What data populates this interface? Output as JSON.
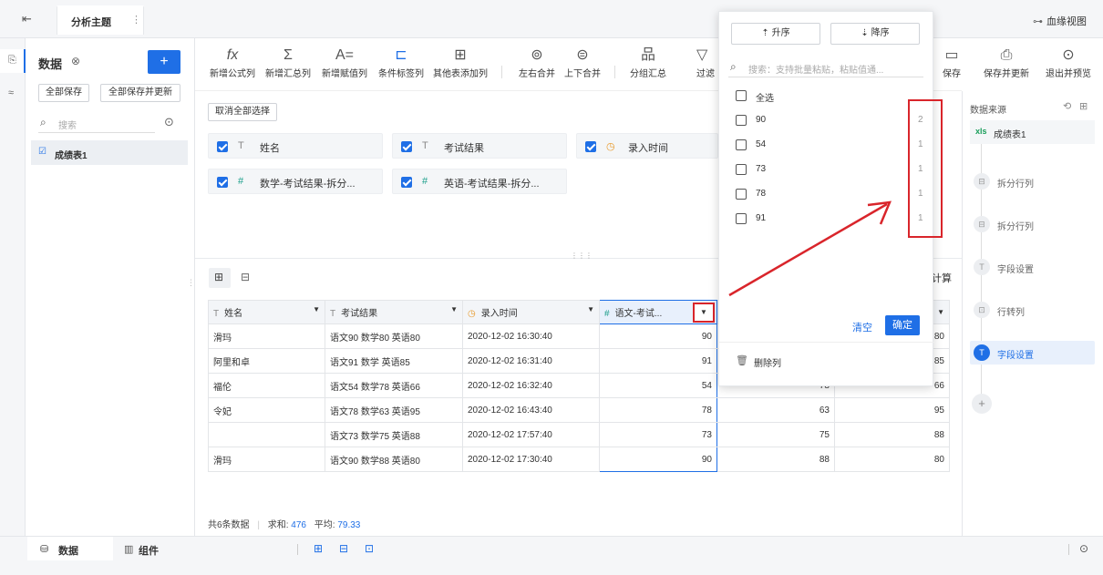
{
  "topbar": {
    "back_icon": "exit-icon",
    "tab_title": "分析主题",
    "more": "⋮",
    "lineage": "血缘视图"
  },
  "left_rail": {
    "icons": [
      "transform-icon",
      "lineage-icon"
    ]
  },
  "data_panel": {
    "title": "数据",
    "add": "+",
    "save_all": "全部保存",
    "save_all_update": "全部保存并更新",
    "search_placeholder": "搜索",
    "tables": [
      "成绩表1"
    ]
  },
  "toolbar": {
    "items": [
      "新增公式列",
      "新增汇总列",
      "新增赋值列",
      "条件标签列",
      "其他表添加列",
      "左右合并",
      "上下合并",
      "分组汇总",
      "过滤"
    ],
    "right_items": [
      "保存",
      "保存并更新",
      "退出并预览"
    ]
  },
  "field_area": {
    "deselect_all": "取消全部选择",
    "fields": [
      {
        "type": "T",
        "name": "姓名"
      },
      {
        "type": "T",
        "name": "考试结果"
      },
      {
        "type": "◷",
        "name": "录入时间"
      },
      {
        "type": "#",
        "name": "数学-考试结果-拆分..."
      },
      {
        "type": "#",
        "name": "英语-考试结果-拆分..."
      }
    ],
    "handle": "⋮⋮⋮"
  },
  "grid": {
    "columns": [
      {
        "type": "T",
        "name": "姓名"
      },
      {
        "type": "T",
        "name": "考试结果"
      },
      {
        "type": "◷",
        "name": "录入时间"
      },
      {
        "type": "#",
        "name": "语文-考试..."
      },
      {
        "type": "#",
        "name": ""
      },
      {
        "type": "#",
        "name": ""
      }
    ],
    "rows": [
      [
        "滑玛",
        "语文90 数学80 英语80",
        "2020-12-02 16:30:40",
        "90",
        "",
        "80"
      ],
      [
        "阿里和卓",
        "语文91 数学 英语85",
        "2020-12-02 16:31:40",
        "91",
        "",
        "85"
      ],
      [
        "福伦",
        "语文54 数学78 英语66",
        "2020-12-02 16:32:40",
        "54",
        "78",
        "66"
      ],
      [
        "令妃",
        "语文78 数学63 英语95",
        "2020-12-02 16:43:40",
        "78",
        "63",
        "95"
      ],
      [
        "",
        "语文73 数学75 英语88",
        "2020-12-02 17:57:40",
        "73",
        "75",
        "88"
      ],
      [
        "滑玛",
        "语文90 数学88 英语80",
        "2020-12-02 17:30:40",
        "90",
        "88",
        "80"
      ]
    ],
    "summary": {
      "count": "共6条数据",
      "sum_label": "求和:",
      "sum": "476",
      "avg_label": "平均:",
      "avg": "79.33"
    },
    "partial_label": "计算"
  },
  "popup": {
    "asc": "升序",
    "desc": "降序",
    "search_placeholder": "搜索：支持批量粘贴，粘贴值通...",
    "select_all": "全选",
    "values": [
      {
        "v": "90",
        "c": "2"
      },
      {
        "v": "54",
        "c": "1"
      },
      {
        "v": "73",
        "c": "1"
      },
      {
        "v": "78",
        "c": "1"
      },
      {
        "v": "91",
        "c": "1"
      }
    ],
    "clear": "清空",
    "confirm": "确定",
    "delete_col": "删除列"
  },
  "right_panel": {
    "title": "数据来源",
    "source": "成绩表1",
    "source_badge": "xls",
    "steps": [
      "拆分行列",
      "拆分行列",
      "字段设置",
      "行转列",
      "字段设置"
    ],
    "active_step": 4
  },
  "bottom": {
    "tab_data": "数据",
    "tab_component": "组件"
  },
  "colors": {
    "accent": "#1f6fe6",
    "highlight": "#d9252b"
  }
}
